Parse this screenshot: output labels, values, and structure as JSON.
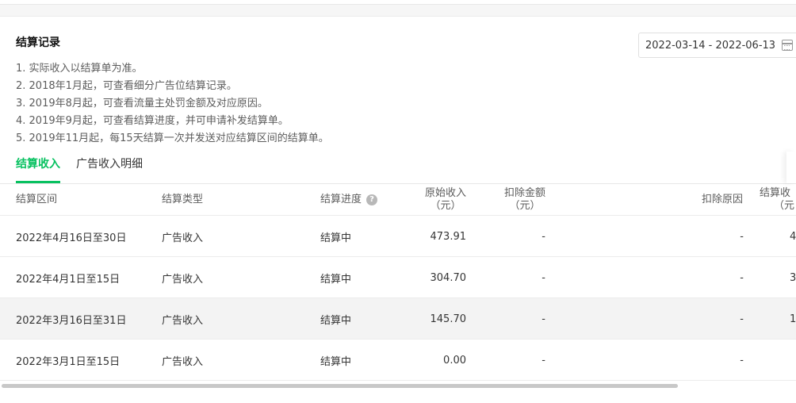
{
  "title": "结算记录",
  "date_range": {
    "value": "2022-03-14 - 2022-06-13",
    "icon": "calendar-icon"
  },
  "notes": [
    "1. 实际收入以结算单为准。",
    "2. 2018年1月起，可查看细分广告位结算记录。",
    "3. 2019年8月起，可查看流量主处罚金额及对应原因。",
    "4. 2019年9月起，可查看结算进度，并可申请补发结算单。",
    "5. 2019年11月起，每15天结算一次并发送对应结算区间的结算单。"
  ],
  "tabs": [
    {
      "label": "结算收入",
      "active": true
    },
    {
      "label": "广告收入明细",
      "active": false
    }
  ],
  "table": {
    "headers": {
      "period": "结算区间",
      "type": "结算类型",
      "progress": "结算进度",
      "original_income_1": "原始收入",
      "original_income_2": "（元）",
      "deduction_1": "扣除金额",
      "deduction_2": "（元）",
      "reason": "扣除原因",
      "settled_1": "结算收",
      "settled_2": "（元"
    },
    "rows": [
      {
        "period": "2022年4月16日至30日",
        "type": "广告收入",
        "progress": "结算中",
        "original": "473.91",
        "deduction": "-",
        "reason": "-",
        "settled": "4"
      },
      {
        "period": "2022年4月1日至15日",
        "type": "广告收入",
        "progress": "结算中",
        "original": "304.70",
        "deduction": "-",
        "reason": "-",
        "settled": "3"
      },
      {
        "period": "2022年3月16日至31日",
        "type": "广告收入",
        "progress": "结算中",
        "original": "145.70",
        "deduction": "-",
        "reason": "-",
        "settled": "1"
      },
      {
        "period": "2022年3月1日至15日",
        "type": "广告收入",
        "progress": "结算中",
        "original": "0.00",
        "deduction": "-",
        "reason": "-",
        "settled": ""
      }
    ]
  },
  "colors": {
    "accent": "#07c160",
    "row_highlight": "#f3f3f3"
  }
}
